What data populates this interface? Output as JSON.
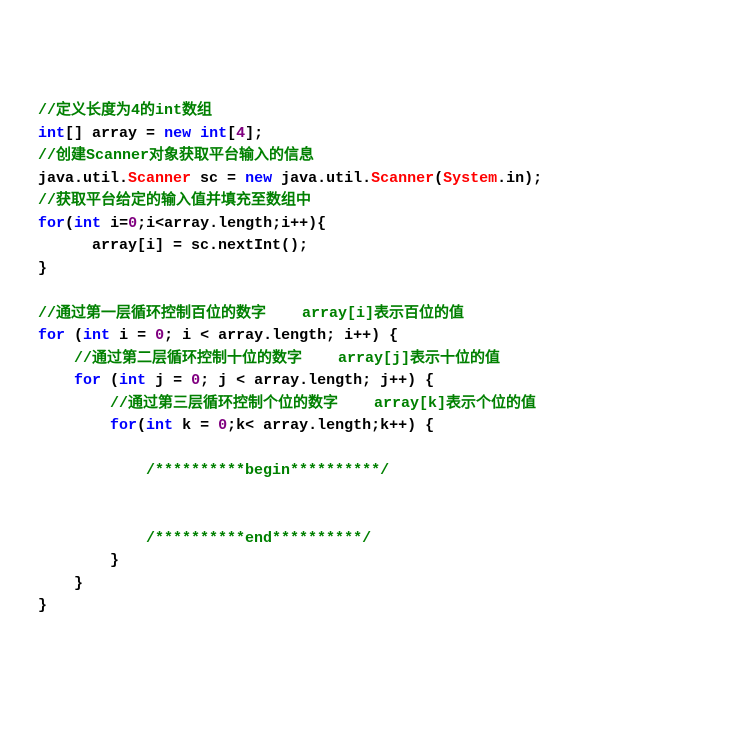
{
  "lines": [
    {
      "indent": "  ",
      "segments": [
        {
          "cls": "cm",
          "t": "//定义长度为4的int数组"
        }
      ]
    },
    {
      "indent": "  ",
      "segments": [
        {
          "cls": "kw",
          "t": "int"
        },
        {
          "cls": "pn",
          "t": "[] array = "
        },
        {
          "cls": "kw",
          "t": "new"
        },
        {
          "cls": "pn",
          "t": " "
        },
        {
          "cls": "kw",
          "t": "int"
        },
        {
          "cls": "pn",
          "t": "["
        },
        {
          "cls": "nm",
          "t": "4"
        },
        {
          "cls": "pn",
          "t": "];"
        }
      ]
    },
    {
      "indent": "  ",
      "segments": [
        {
          "cls": "cm",
          "t": "//创建Scanner对象获取平台输入的信息"
        }
      ]
    },
    {
      "indent": "  ",
      "segments": [
        {
          "cls": "id",
          "t": "java.util."
        },
        {
          "cls": "ty",
          "t": "Scanner"
        },
        {
          "cls": "id",
          "t": " sc = "
        },
        {
          "cls": "kw",
          "t": "new"
        },
        {
          "cls": "id",
          "t": " java.util."
        },
        {
          "cls": "ty",
          "t": "Scanner"
        },
        {
          "cls": "pn",
          "t": "("
        },
        {
          "cls": "ty",
          "t": "System"
        },
        {
          "cls": "pn",
          "t": ".in);"
        }
      ]
    },
    {
      "indent": "  ",
      "segments": [
        {
          "cls": "cm",
          "t": "//获取平台给定的输入值并填充至数组中"
        }
      ]
    },
    {
      "indent": "  ",
      "segments": [
        {
          "cls": "kw",
          "t": "for"
        },
        {
          "cls": "pn",
          "t": "("
        },
        {
          "cls": "kw",
          "t": "int"
        },
        {
          "cls": "pn",
          "t": " i="
        },
        {
          "cls": "nm",
          "t": "0"
        },
        {
          "cls": "pn",
          "t": ";i<array.length;i++){"
        }
      ]
    },
    {
      "indent": "        ",
      "segments": [
        {
          "cls": "pn",
          "t": "array[i] = sc.nextInt();"
        }
      ]
    },
    {
      "indent": "  ",
      "segments": [
        {
          "cls": "pn",
          "t": "}"
        }
      ]
    },
    {
      "indent": "",
      "segments": []
    },
    {
      "indent": "  ",
      "segments": [
        {
          "cls": "cm",
          "t": "//通过第一层循环控制百位的数字    array[i]表示百位的值"
        }
      ]
    },
    {
      "indent": "  ",
      "segments": [
        {
          "cls": "kw",
          "t": "for"
        },
        {
          "cls": "pn",
          "t": " ("
        },
        {
          "cls": "kw",
          "t": "int"
        },
        {
          "cls": "pn",
          "t": " i = "
        },
        {
          "cls": "nm",
          "t": "0"
        },
        {
          "cls": "pn",
          "t": "; i < array.length; i++) {"
        }
      ]
    },
    {
      "indent": "      ",
      "segments": [
        {
          "cls": "cm",
          "t": "//通过第二层循环控制十位的数字    array[j]表示十位的值"
        }
      ]
    },
    {
      "indent": "      ",
      "segments": [
        {
          "cls": "kw",
          "t": "for"
        },
        {
          "cls": "pn",
          "t": " ("
        },
        {
          "cls": "kw",
          "t": "int"
        },
        {
          "cls": "pn",
          "t": " j = "
        },
        {
          "cls": "nm",
          "t": "0"
        },
        {
          "cls": "pn",
          "t": "; j < array.length; j++) {"
        }
      ]
    },
    {
      "indent": "          ",
      "segments": [
        {
          "cls": "cm",
          "t": "//通过第三层循环控制个位的数字    array[k]表示个位的值"
        }
      ]
    },
    {
      "indent": "          ",
      "segments": [
        {
          "cls": "kw",
          "t": "for"
        },
        {
          "cls": "pn",
          "t": "("
        },
        {
          "cls": "kw",
          "t": "int"
        },
        {
          "cls": "pn",
          "t": " k = "
        },
        {
          "cls": "nm",
          "t": "0"
        },
        {
          "cls": "pn",
          "t": ";k< array.length;k++) {"
        }
      ]
    },
    {
      "indent": "",
      "segments": []
    },
    {
      "indent": "              ",
      "segments": [
        {
          "cls": "cm",
          "t": "/**********begin**********/"
        }
      ]
    },
    {
      "indent": "",
      "segments": []
    },
    {
      "indent": "",
      "segments": []
    },
    {
      "indent": "              ",
      "segments": [
        {
          "cls": "cm",
          "t": "/**********end**********/"
        }
      ]
    },
    {
      "indent": "          ",
      "segments": [
        {
          "cls": "pn",
          "t": "}"
        }
      ]
    },
    {
      "indent": "      ",
      "segments": [
        {
          "cls": "pn",
          "t": "}"
        }
      ]
    },
    {
      "indent": "  ",
      "segments": [
        {
          "cls": "pn",
          "t": "}"
        }
      ]
    }
  ]
}
